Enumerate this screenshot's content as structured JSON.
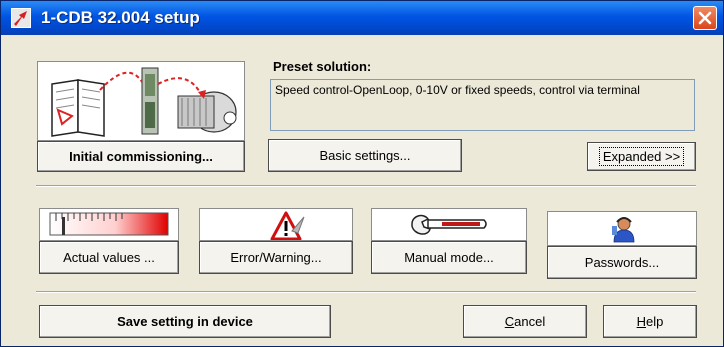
{
  "window": {
    "title": "1-CDB 32.004 setup"
  },
  "icons": {
    "title": "app-icon",
    "close": "close-icon",
    "commissioning": "commissioning-illustration-icon",
    "actual_values": "meter-gauge-icon",
    "error": "warning-triangle-icon",
    "manual": "wrench-icon",
    "passwords": "user-key-icon"
  },
  "preset": {
    "label": "Preset solution:",
    "text": "Speed control-OpenLoop, 0-10V or fixed speeds, control via terminal"
  },
  "buttons": {
    "initial_commissioning": "Initial commissioning...",
    "basic_settings": "Basic settings...",
    "expanded": "Expanded >>",
    "actual_values": "Actual values ...",
    "error_warning": "Error/Warning...",
    "manual_mode": "Manual mode...",
    "passwords": "Passwords...",
    "save_setting": "Save setting in device",
    "cancel_first": "C",
    "cancel_rest": "ancel",
    "help_first": "H",
    "help_rest": "elp"
  },
  "colors": {
    "titlebar": "#0054e3",
    "close": "#d9461c",
    "dialog_bg": "#ece9d8"
  }
}
